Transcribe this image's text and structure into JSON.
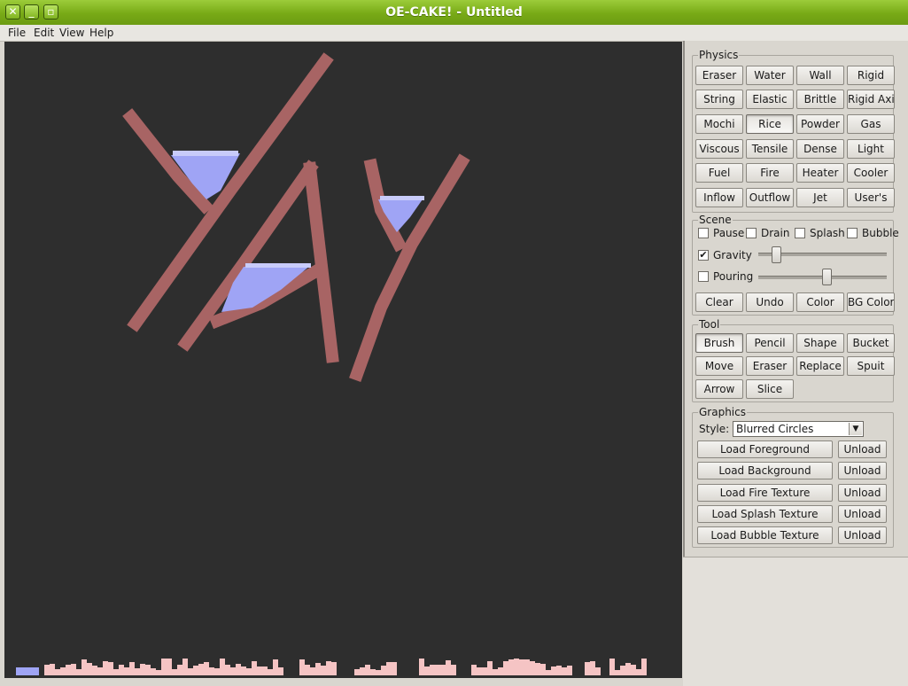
{
  "window": {
    "title": "OE-CAKE! - Untitled"
  },
  "menu": [
    "File",
    "Edit",
    "View",
    "Help"
  ],
  "physics": {
    "label": "Physics",
    "buttons": [
      "Eraser",
      "Water",
      "Wall",
      "Rigid",
      "String",
      "Elastic",
      "Brittle",
      "Rigid Axis",
      "Mochi",
      "Rice",
      "Powder",
      "Gas",
      "Viscous",
      "Tensile",
      "Dense",
      "Light",
      "Fuel",
      "Fire",
      "Heater",
      "Cooler",
      "Inflow",
      "Outflow",
      "Jet",
      "User's"
    ],
    "selected": "Rice"
  },
  "scene": {
    "label": "Scene",
    "checks": [
      {
        "label": "Pause",
        "checked": false
      },
      {
        "label": "Drain",
        "checked": false
      },
      {
        "label": "Splash",
        "checked": false
      },
      {
        "label": "Bubble",
        "checked": false
      }
    ],
    "gravity": {
      "label": "Gravity",
      "checked": true,
      "level": 0.08
    },
    "pouring": {
      "label": "Pouring",
      "checked": false,
      "level": 0.5
    },
    "buttons": [
      "Clear",
      "Undo",
      "Color",
      "BG Color"
    ]
  },
  "tool": {
    "label": "Tool",
    "buttons": [
      "Brush",
      "Pencil",
      "Shape",
      "Bucket",
      "Move",
      "Eraser",
      "Replace",
      "Spuit",
      "Arrow",
      "Slice"
    ],
    "selected": "Brush"
  },
  "graphics": {
    "label": "Graphics",
    "style_label": "Style:",
    "style_value": "Blurred Circles",
    "loads": [
      "Load Foreground",
      "Load Background",
      "Load Fire Texture",
      "Load Splash Texture",
      "Load Bubble Texture"
    ],
    "unload_label": "Unload"
  },
  "colors": {
    "wall": "#a86464",
    "water": "#9fa4f5",
    "water_light": "#c8cbfa",
    "powder": "#f5c4c4",
    "canvas_bg": "#2e2e2e"
  }
}
